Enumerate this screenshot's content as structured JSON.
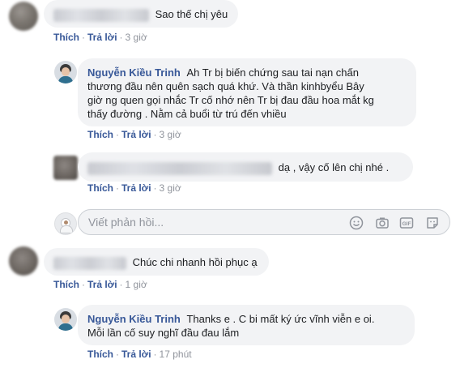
{
  "colors": {
    "link": "#385898",
    "bubble": "#f2f3f5",
    "meta": "#90949c"
  },
  "comments": [
    {
      "author_visible": false,
      "text": "Sao thế chị yêu",
      "actions": {
        "like": "Thích",
        "reply": "Trả lời",
        "time": "3 giờ"
      }
    },
    {
      "author": "Nguyễn Kiều Trinh",
      "text_lines": [
        "Ah Tr bị biến chứng sau tai nạn chấn",
        "thương đầu nên quên sạch quá khứ. Và thần kinhbyểu Bây",
        "giờ ng quen gọi nhắc Tr cố nhớ nên Tr bị đau đầu hoa mắt kg",
        "thấy đường . Nằm cả buổi từ trú đến vhiều"
      ],
      "actions": {
        "like": "Thích",
        "reply": "Trả lời",
        "time": "3 giờ"
      }
    },
    {
      "author_visible": false,
      "text": "dạ , vậy cố lên chị nhé .",
      "actions": {
        "like": "Thích",
        "reply": "Trả lời",
        "time": "3 giờ"
      }
    },
    {
      "author_visible": false,
      "text": "Chúc chi nhanh hồi phục ạ",
      "actions": {
        "like": "Thích",
        "reply": "Trả lời",
        "time": "1 giờ"
      }
    },
    {
      "author": "Nguyễn Kiều Trinh",
      "text_lines": [
        "Thanks e . C bi mất ký ức vĩnh viễn e oi.",
        "Mỗi lần cố suy nghĩ đầu đau lắm"
      ],
      "actions": {
        "like": "Thích",
        "reply": "Trả lời",
        "time": "17 phút"
      }
    }
  ],
  "composer": {
    "placeholder": "Viết phản hồi...",
    "tools": [
      "emoji-icon",
      "camera-icon",
      "gif-icon",
      "sticker-icon"
    ]
  }
}
